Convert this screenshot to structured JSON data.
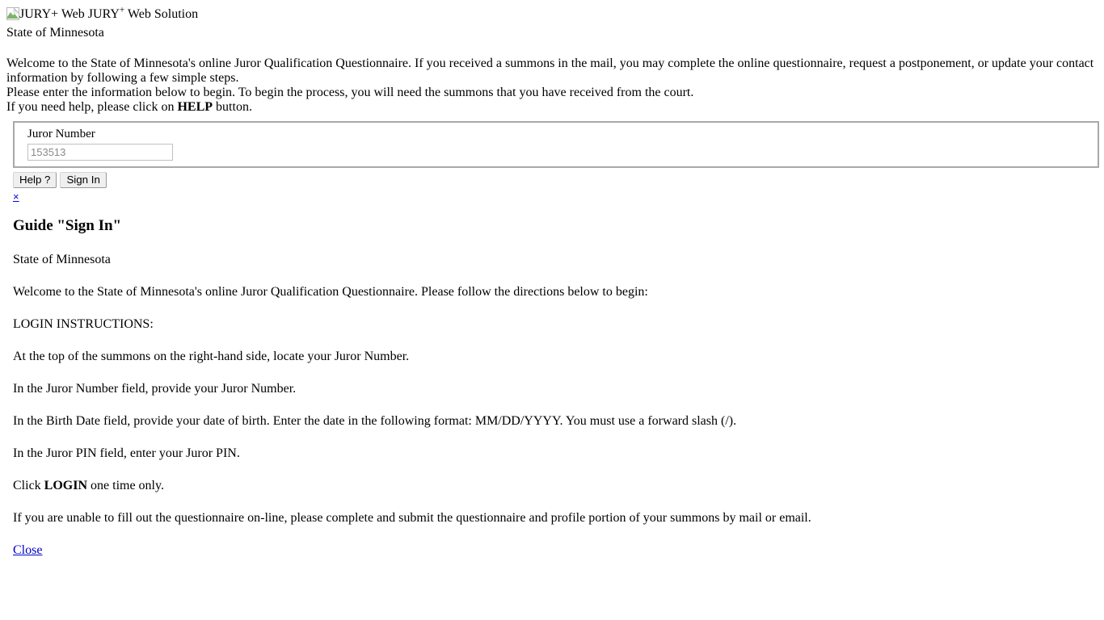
{
  "header": {
    "logo_alt": "JURY+ Web",
    "logo_icon": "broken-image-icon",
    "title_main": "JURY",
    "title_sup": "+",
    "title_rest": " Web Solution",
    "subtitle": "State of Minnesota"
  },
  "intro": {
    "line1": "Welcome to the State of Minnesota's online Juror Qualification Questionnaire.  If you received a summons in the mail, you may complete the online questionnaire, request a postponement, or update your contact information by following a few simple steps.",
    "line2": "Please enter the information below to begin. To begin the process, you will need the summons that you have received from the court.",
    "line3_before": "If you need help, please click on ",
    "line3_bold": "HELP",
    "line3_after": " button."
  },
  "login": {
    "juror_number_label": "Juror Number",
    "juror_number_value": "",
    "juror_number_placeholder": "153513"
  },
  "buttons": {
    "help": "Help ?",
    "signin": "Sign In"
  },
  "dismiss": {
    "x_label": "×"
  },
  "guide": {
    "heading": "Guide \"Sign In\"",
    "state": "State of Minnesota",
    "welcome": "Welcome to the State of Minnesota's online Juror Qualification Questionnaire. Please follow the directions below to begin:",
    "login_instructions_heading": "LOGIN INSTRUCTIONS:",
    "step1": "At the top of the summons on the right-hand side, locate your Juror Number.",
    "step2": "In the Juror Number field, provide your Juror Number.",
    "step3": "In the Birth Date field, provide your date of birth.  Enter the date in the following format:  MM/DD/YYYY.  You must use a forward slash (/).",
    "step4": "In the Juror PIN field, enter your Juror PIN.",
    "step5_before": "Click ",
    "step5_bold": "LOGIN",
    "step5_after": " one time only.",
    "mail_note": "If you are unable to fill out the questionnaire on-line, please complete and submit the questionnaire and profile portion of your summons by mail or email.",
    "close_link": "Close"
  },
  "colors": {
    "link": "#0000ee",
    "close_link": "#0000cc",
    "fieldset_border": "#a8a8a8",
    "placeholder": "#8a8a8a"
  }
}
